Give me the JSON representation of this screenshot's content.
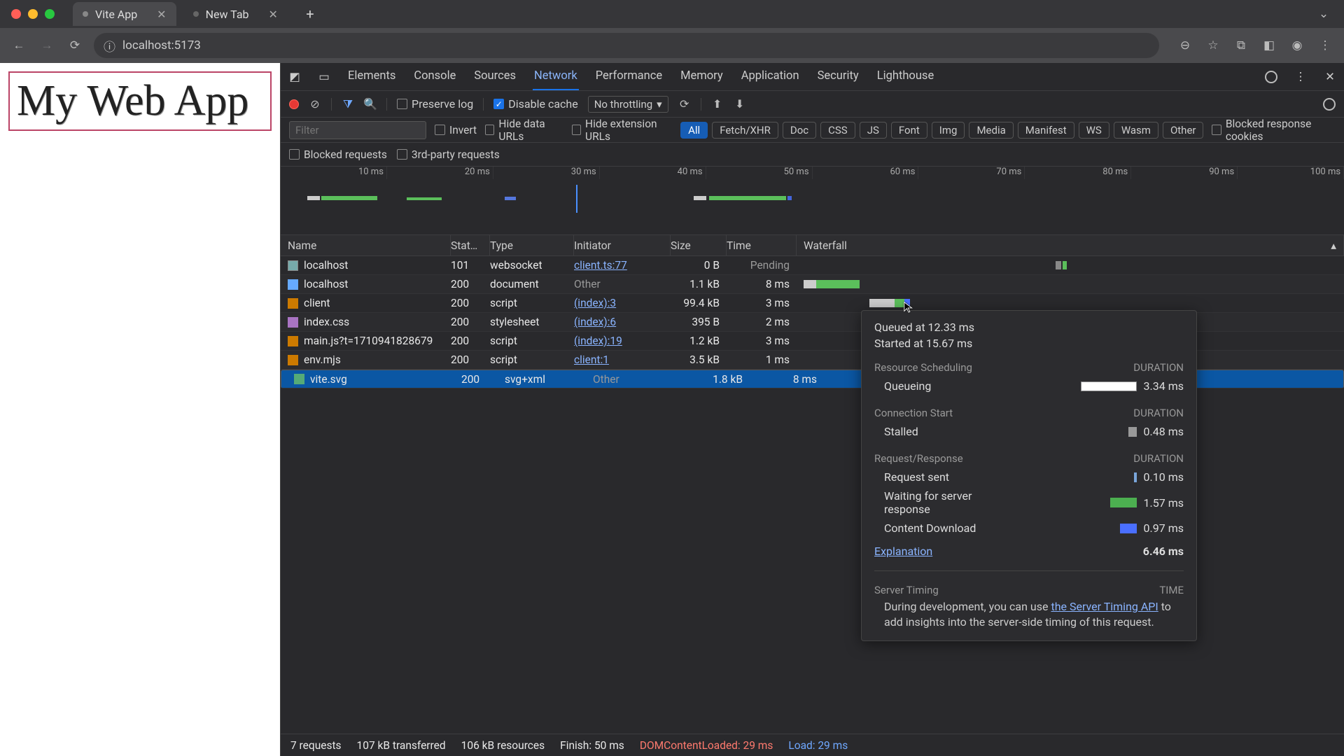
{
  "window": {
    "tab1_title": "Vite App",
    "tab2_title": "New Tab",
    "url": "localhost:5173"
  },
  "page": {
    "heading": "My Web App"
  },
  "devtools_tabs": [
    "Elements",
    "Console",
    "Sources",
    "Network",
    "Performance",
    "Memory",
    "Application",
    "Security",
    "Lighthouse"
  ],
  "toolbar": {
    "preserve_log": "Preserve log",
    "disable_cache": "Disable cache",
    "throttling": "No throttling"
  },
  "filter": {
    "placeholder": "Filter",
    "invert": "Invert",
    "hide_data": "Hide data URLs",
    "hide_ext": "Hide extension URLs",
    "blocked_cookies": "Blocked response cookies",
    "blocked_req": "Blocked requests",
    "third_party": "3rd-party requests"
  },
  "type_pills": [
    "All",
    "Fetch/XHR",
    "Doc",
    "CSS",
    "JS",
    "Font",
    "Img",
    "Media",
    "Manifest",
    "WS",
    "Wasm",
    "Other"
  ],
  "overview_ticks": [
    "10 ms",
    "20 ms",
    "30 ms",
    "40 ms",
    "50 ms",
    "60 ms",
    "70 ms",
    "80 ms",
    "90 ms",
    "100 ms"
  ],
  "columns": {
    "name": "Name",
    "status": "Stat…",
    "type": "Type",
    "initiator": "Initiator",
    "size": "Size",
    "time": "Time",
    "waterfall": "Waterfall"
  },
  "requests": [
    {
      "name": "localhost",
      "status": "101",
      "type": "websocket",
      "initiator": "client.ts:77",
      "init_link": true,
      "size": "0 B",
      "time": "Pending",
      "icon": "ws"
    },
    {
      "name": "localhost",
      "status": "200",
      "type": "document",
      "initiator": "Other",
      "init_link": false,
      "size": "1.1 kB",
      "time": "8 ms",
      "icon": "doc"
    },
    {
      "name": "client",
      "status": "200",
      "type": "script",
      "initiator": "(index):3",
      "init_link": true,
      "size": "99.4 kB",
      "time": "3 ms",
      "icon": "js"
    },
    {
      "name": "index.css",
      "status": "200",
      "type": "stylesheet",
      "initiator": "(index):6",
      "init_link": true,
      "size": "395 B",
      "time": "2 ms",
      "icon": "css"
    },
    {
      "name": "main.js?t=1710941828679",
      "status": "200",
      "type": "script",
      "initiator": "(index):19",
      "init_link": true,
      "size": "1.2 kB",
      "time": "3 ms",
      "icon": "js"
    },
    {
      "name": "env.mjs",
      "status": "200",
      "type": "script",
      "initiator": "client:1",
      "init_link": true,
      "size": "3.5 kB",
      "time": "1 ms",
      "icon": "js"
    },
    {
      "name": "vite.svg",
      "status": "200",
      "type": "svg+xml",
      "initiator": "Other",
      "init_link": false,
      "size": "1.8 kB",
      "time": "8 ms",
      "icon": "img",
      "selected": true
    }
  ],
  "timing": {
    "queued": "Queued at 12.33 ms",
    "started": "Started at 15.67 ms",
    "sec_scheduling": "Resource Scheduling",
    "sec_conn": "Connection Start",
    "sec_req": "Request/Response",
    "duration": "DURATION",
    "queueing": "Queueing",
    "queueing_v": "3.34 ms",
    "stalled": "Stalled",
    "stalled_v": "0.48 ms",
    "sent": "Request sent",
    "sent_v": "0.10 ms",
    "waiting": "Waiting for server response",
    "waiting_v": "1.57 ms",
    "download": "Content Download",
    "download_v": "0.97 ms",
    "explanation": "Explanation",
    "total": "6.46 ms",
    "server_timing": "Server Timing",
    "time_hdr": "TIME",
    "server_msg1": "During development, you can use ",
    "server_link": "the Server Timing API",
    "server_msg2": " to add insights into the server-side timing of this request."
  },
  "status": {
    "requests": "7 requests",
    "transferred": "107 kB transferred",
    "resources": "106 kB resources",
    "finish": "Finish: 50 ms",
    "dom": "DOMContentLoaded: 29 ms",
    "load": "Load: 29 ms"
  }
}
